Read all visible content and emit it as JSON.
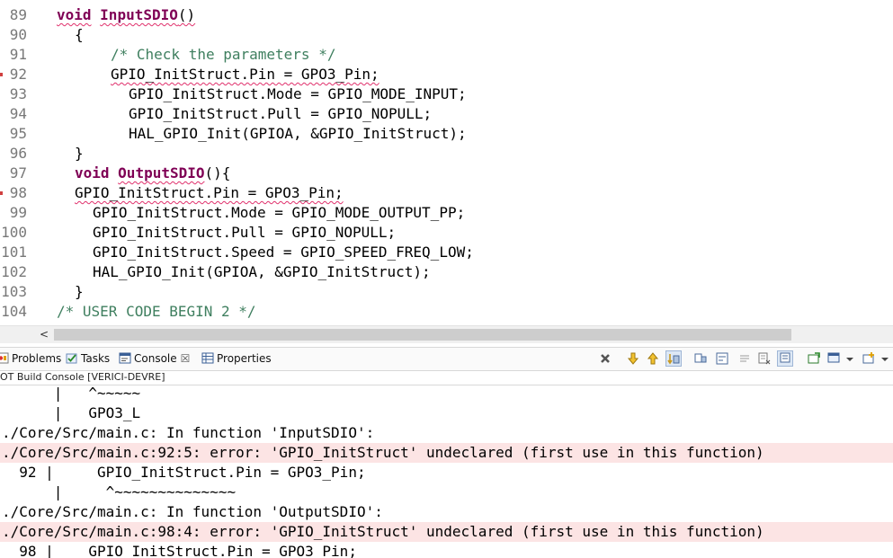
{
  "editor": {
    "lines": [
      {
        "num": "89",
        "segments": [
          {
            "text": "void",
            "cls": "kw sq"
          },
          {
            "text": " ",
            "cls": ""
          },
          {
            "text": "InputSDIO",
            "cls": "kw sq"
          },
          {
            "text": "()",
            "cls": "sq"
          }
        ],
        "indent": 63,
        "breakpoint": false
      },
      {
        "num": "90",
        "segments": [
          {
            "text": "{",
            "cls": ""
          }
        ],
        "indent": 83,
        "breakpoint": false
      },
      {
        "num": "91",
        "segments": [
          {
            "text": "/* Check the parameters */",
            "cls": "cm"
          }
        ],
        "indent": 123,
        "breakpoint": false
      },
      {
        "num": "92",
        "segments": [
          {
            "text": "GPIO_InitStruct.Pin = GPO3_Pin;",
            "cls": "sq"
          }
        ],
        "indent": 123,
        "breakpoint": true
      },
      {
        "num": "93",
        "segments": [
          {
            "text": "GPIO_InitStruct.Mode = GPIO_MODE_INPUT;",
            "cls": ""
          }
        ],
        "indent": 143,
        "breakpoint": false
      },
      {
        "num": "94",
        "segments": [
          {
            "text": "GPIO_InitStruct.Pull = GPIO_NOPULL;",
            "cls": ""
          }
        ],
        "indent": 143,
        "breakpoint": false
      },
      {
        "num": "95",
        "segments": [
          {
            "text": "HAL_GPIO_Init(GPIOA, &GPIO_InitStruct);",
            "cls": ""
          }
        ],
        "indent": 143,
        "breakpoint": false
      },
      {
        "num": "96",
        "segments": [
          {
            "text": "}",
            "cls": ""
          }
        ],
        "indent": 83,
        "breakpoint": false
      },
      {
        "num": "97",
        "segments": [
          {
            "text": "void",
            "cls": "kw"
          },
          {
            "text": " ",
            "cls": ""
          },
          {
            "text": "OutputSDIO",
            "cls": "kw sq"
          },
          {
            "text": "(){",
            "cls": ""
          }
        ],
        "indent": 83,
        "breakpoint": false
      },
      {
        "num": "98",
        "segments": [
          {
            "text": "GPIO_InitStruct.Pin = GPO3_Pin;",
            "cls": "sq"
          }
        ],
        "indent": 83,
        "breakpoint": true
      },
      {
        "num": "99",
        "segments": [
          {
            "text": "GPIO_InitStruct.Mode = GPIO_MODE_OUTPUT_PP;",
            "cls": ""
          }
        ],
        "indent": 103,
        "breakpoint": false
      },
      {
        "num": "100",
        "segments": [
          {
            "text": "GPIO_InitStruct.Pull = GPIO_NOPULL;",
            "cls": ""
          }
        ],
        "indent": 103,
        "breakpoint": false
      },
      {
        "num": "101",
        "segments": [
          {
            "text": "GPIO_InitStruct.Speed = GPIO_SPEED_FREQ_LOW;",
            "cls": ""
          }
        ],
        "indent": 103,
        "breakpoint": false
      },
      {
        "num": "102",
        "segments": [
          {
            "text": "HAL_GPIO_Init(GPIOA, &GPIO_InitStruct);",
            "cls": ""
          }
        ],
        "indent": 103,
        "breakpoint": false
      },
      {
        "num": "103",
        "segments": [
          {
            "text": "}",
            "cls": ""
          }
        ],
        "indent": 83,
        "breakpoint": false
      },
      {
        "num": "104",
        "segments": [
          {
            "text": "/* USER CODE BEGIN 2 */",
            "cls": "cm"
          }
        ],
        "indent": 63,
        "breakpoint": false
      }
    ]
  },
  "scrollbar": {
    "left_arrow": "<"
  },
  "views": {
    "tabs": [
      {
        "id": "problems",
        "label": "Problems",
        "icon": "problems-icon"
      },
      {
        "id": "tasks",
        "label": "Tasks",
        "icon": "tasks-icon"
      },
      {
        "id": "console",
        "label": "Console",
        "icon": "console-icon",
        "close": "☒",
        "active": true
      },
      {
        "id": "properties",
        "label": "Properties",
        "icon": "properties-icon"
      }
    ],
    "toolbar_icons": [
      "terminate-icon",
      "scroll-down-icon",
      "scroll-up-icon",
      "scroll-lock-icon",
      "pin-icon",
      "word-wrap-icon",
      "clear-icon",
      "copy-icon",
      "show-console-icon",
      "open-console-icon",
      "display-console-icon",
      "new-console-icon"
    ]
  },
  "console": {
    "title": "OT Build Console [VERICI-DEVRE]",
    "lines": [
      {
        "text": "      |   ^~~~~~",
        "error": false
      },
      {
        "text": "      |   GPO3_L",
        "error": false
      },
      {
        "text": "./Core/Src/main.c: In function 'InputSDIO':",
        "error": false
      },
      {
        "text": "./Core/Src/main.c:92:5: error: 'GPIO_InitStruct' undeclared (first use in this function)",
        "error": true
      },
      {
        "text": "  92 |     GPIO_InitStruct.Pin = GPO3_Pin;",
        "error": false
      },
      {
        "text": "      |     ^~~~~~~~~~~~~~~",
        "error": false
      },
      {
        "text": "./Core/Src/main.c: In function 'OutputSDIO':",
        "error": false
      },
      {
        "text": "./Core/Src/main.c:98:4: error: 'GPIO_InitStruct' undeclared (first use in this function)",
        "error": true
      },
      {
        "text": "  98 |    GPIO_InitStruct.Pin = GPO3_Pin;",
        "error": false
      }
    ]
  },
  "colors": {
    "keyword": "#7f0055",
    "comment": "#3f7f5f",
    "error_bg": "#fce4e4",
    "squiggle": "#e0306c"
  }
}
